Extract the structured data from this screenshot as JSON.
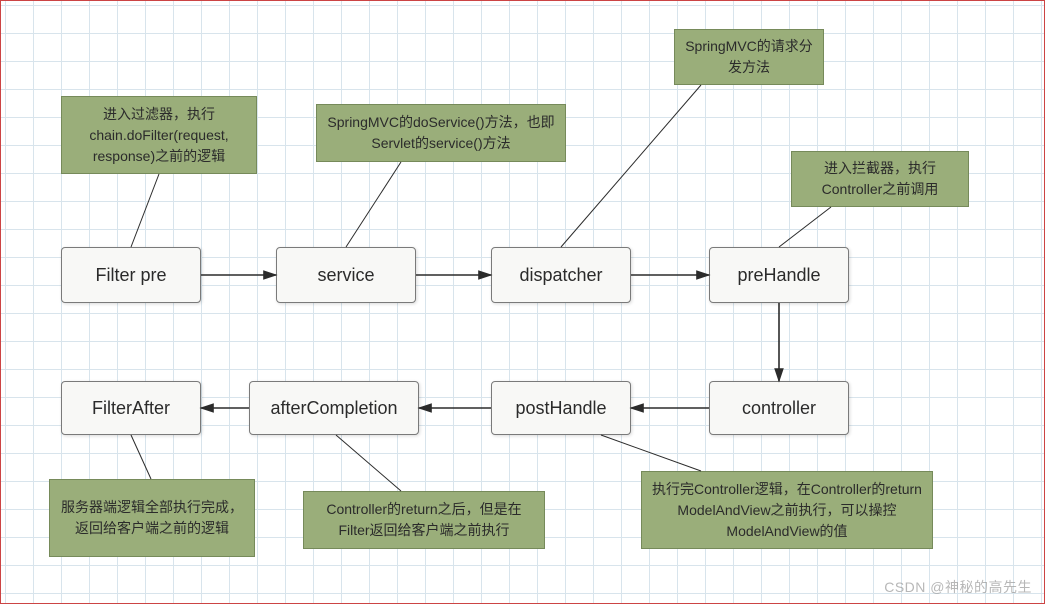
{
  "nodes": {
    "filter_pre": "Filter pre",
    "service": "service",
    "dispatcher": "dispatcher",
    "pre_handle": "preHandle",
    "controller": "controller",
    "post_handle": "postHandle",
    "after_completion": "afterCompletion",
    "filter_after": "FilterAfter"
  },
  "notes": {
    "note_filter_pre": "进入过滤器，执行chain.doFilter(request, response)之前的逻辑",
    "note_service": "SpringMVC的doService()方法，也即Servlet的service()方法",
    "note_dispatcher": "SpringMVC的请求分发方法",
    "note_pre_handle": "进入拦截器，执行Controller之前调用",
    "note_post_handle": "执行完Controller逻辑，在Controller的return ModelAndView之前执行，可以操控ModelAndView的值",
    "note_after_completion": "Controller的return之后，但是在Filter返回给客户端之前执行",
    "note_filter_after": "服务器端逻辑全部执行完成，返回给客户端之前的逻辑"
  },
  "watermark": "CSDN @神秘的高先生",
  "colors": {
    "node_bg": "#f8f8f6",
    "note_bg": "#9aae7a",
    "border_frame": "#cc4444",
    "grid": "#d8e4ec"
  }
}
